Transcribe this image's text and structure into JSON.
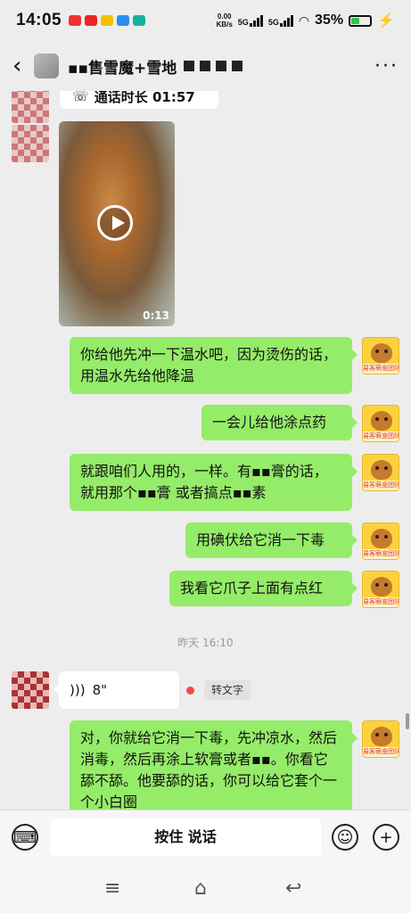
{
  "status": {
    "time": "14:05",
    "net_speed": "0.00\nKB/s",
    "sig1": "5G",
    "sig2": "5G",
    "battery": "35%"
  },
  "nav": {
    "title": "▪▪售雪魔+雪地"
  },
  "messages": {
    "call": "通话时长 01:57",
    "video_duration": "0:13",
    "m1": "你给他先冲一下温水吧，因为烫伤的话，用温水先给他降温",
    "m2": "一会儿给他涂点药",
    "m3": "就跟咱们人用的，一样。有▪▪膏的话，就用那个▪▪膏 或者搞点▪▪素",
    "m4": "用碘伏给它消一下毒",
    "m5": "我看它爪子上面有点红",
    "timestamp": "昨天 16:10",
    "voice_duration": "8\"",
    "transcribe": "转文字",
    "m6": "对，你就给它消一下毒，先冲凉水，然后消毒，然后再涂上软膏或者▪▪。你看它舔不舔。他要舔的话，你可以给它套个一个小白圈"
  },
  "avatar_tag": "易客萌宠团队",
  "input": {
    "hold_to_talk": "按住 说话"
  },
  "icons": {
    "keyboard": "keyboard-icon",
    "emoji": "emoji-icon",
    "plus": "plus-icon"
  }
}
